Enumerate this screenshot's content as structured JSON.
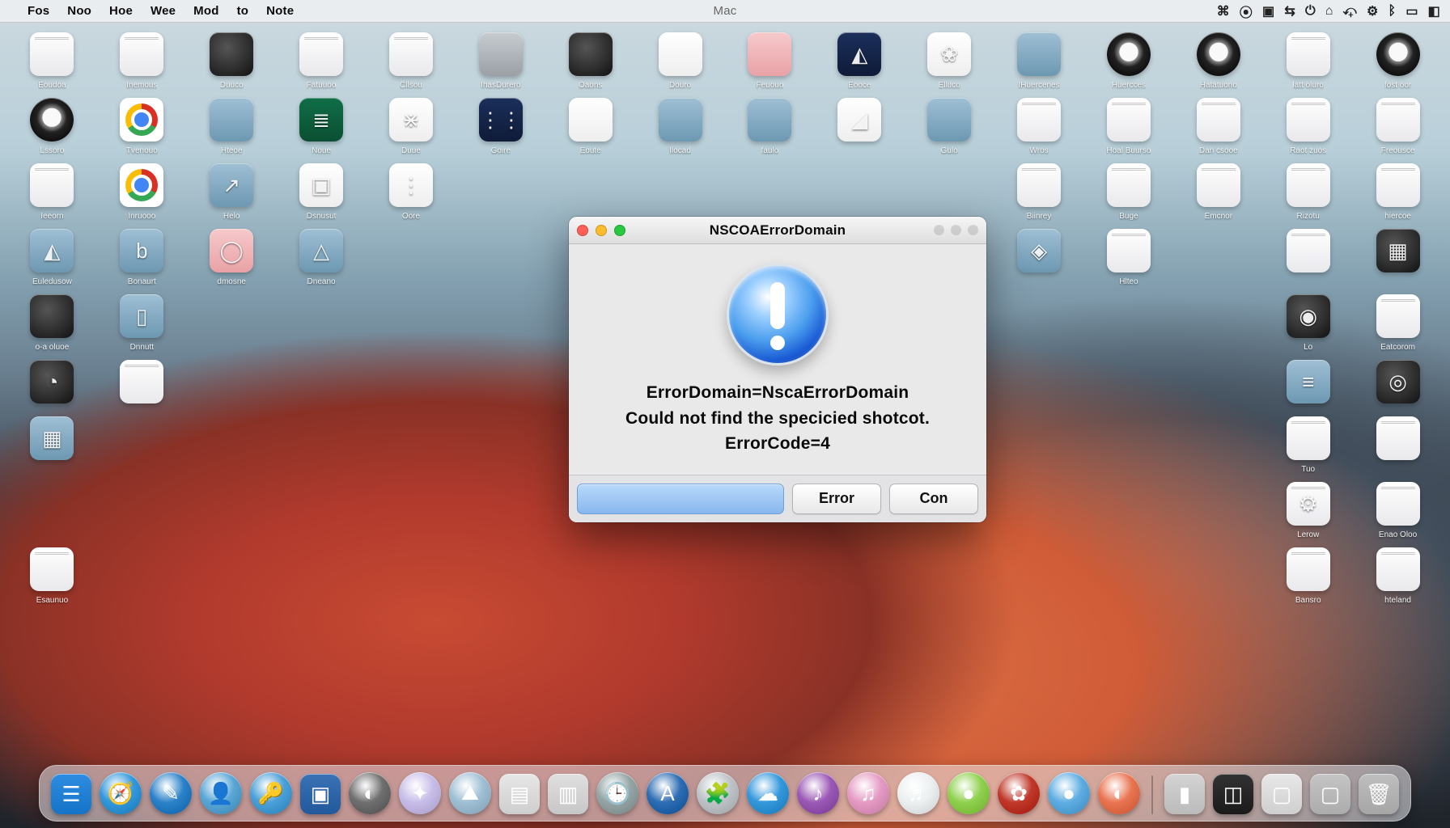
{
  "menubar": {
    "center": "Mac",
    "items": [
      "Fos",
      "Noo",
      "Hoe",
      "Wee",
      "Mod",
      "to",
      "Note"
    ]
  },
  "dialog": {
    "title": "NSCOAErrorDomain",
    "line1": "ErrorDomain=NscaErrorDomain",
    "line2": "Could not find the specicied shotcot.",
    "line3": "ErrorCode=4",
    "button1": "Error",
    "button2": "Con"
  },
  "icons": {
    "r1": [
      {
        "l": "Eoudoa",
        "t": "paper"
      },
      {
        "l": "Inemous",
        "t": "paper"
      },
      {
        "l": "Duuco",
        "t": "dark"
      },
      {
        "l": "Fatuuoo",
        "t": "paper"
      },
      {
        "l": "Cllsou",
        "t": "paper"
      },
      {
        "l": "IhasDurero",
        "t": "steel"
      },
      {
        "l": "Oaons",
        "t": "dark"
      },
      {
        "l": "Douro",
        "t": "white"
      },
      {
        "l": "Feuouo",
        "t": "pink"
      },
      {
        "l": "Eooce",
        "t": "navy",
        "g": "◭"
      },
      {
        "l": "Elluco",
        "t": "white",
        "g": "❀"
      },
      {
        "l": "IHuercenes",
        "t": "blue"
      },
      {
        "l": "Huercces",
        "t": "ring"
      },
      {
        "l": "Hatatuono",
        "t": "ring"
      },
      {
        "l": "latt oluro",
        "t": "paper"
      },
      {
        "l": "fost oor",
        "t": "ring"
      }
    ],
    "r2": [
      {
        "l": "Lssoro",
        "t": "ring"
      },
      {
        "l": "Tvenouo",
        "t": "chrome"
      },
      {
        "l": "Hteoe",
        "t": "blue"
      },
      {
        "l": "Noue",
        "t": "green",
        "g": "≣"
      },
      {
        "l": "Duue",
        "t": "white",
        "g": "⋇"
      },
      {
        "l": "Goire",
        "t": "navy",
        "g": "⋮⋮"
      },
      {
        "l": "Eoute",
        "t": "white"
      },
      {
        "l": "Ilocad",
        "t": "blue"
      },
      {
        "l": "faulo",
        "t": "blue"
      },
      {
        "l": "",
        "t": "white",
        "g": "◢"
      },
      {
        "l": "Gulo",
        "t": "blue"
      },
      {
        "l": "Wros",
        "t": "paper"
      },
      {
        "l": "Hoal Buurso",
        "t": "paper"
      },
      {
        "l": "Dan csooe",
        "t": "paper"
      },
      {
        "l": "Raot zuos",
        "t": "paper"
      },
      {
        "l": "Freousce",
        "t": "paper"
      }
    ],
    "r3": [
      {
        "l": "Ieeorn",
        "t": "paper"
      },
      {
        "l": "Inruooo",
        "t": "chrome"
      },
      {
        "l": "Helo",
        "t": "blue",
        "g": "↗"
      },
      {
        "l": "Dsnusut",
        "t": "white",
        "g": "▣"
      },
      {
        "l": "Oore",
        "t": "white",
        "g": "⋮"
      },
      {
        "l": "",
        "t": ""
      },
      {
        "l": "",
        "t": ""
      },
      {
        "l": "",
        "t": ""
      },
      {
        "l": "",
        "t": ""
      },
      {
        "l": "",
        "t": ""
      },
      {
        "l": "",
        "t": ""
      },
      {
        "l": "Biinrey",
        "t": "paper"
      },
      {
        "l": "Buge",
        "t": "paper"
      },
      {
        "l": "Emcnor",
        "t": "paper"
      },
      {
        "l": "Rizotu",
        "t": "paper"
      },
      {
        "l": "hiercoe",
        "t": "paper"
      }
    ],
    "r4": [
      {
        "l": "Euledusow",
        "t": "blue",
        "g": "◭"
      },
      {
        "l": "Bonaurt",
        "t": "blue",
        "g": "b"
      },
      {
        "l": "dmosne",
        "t": "pink",
        "g": "◯"
      },
      {
        "l": "Dneano",
        "t": "blue",
        "g": "△"
      },
      {
        "l": "",
        "t": ""
      },
      {
        "l": "",
        "t": ""
      },
      {
        "l": "",
        "t": ""
      },
      {
        "l": "",
        "t": ""
      },
      {
        "l": "",
        "t": ""
      },
      {
        "l": "",
        "t": ""
      },
      {
        "l": "",
        "t": ""
      },
      {
        "l": "",
        "t": "blue",
        "g": "◈"
      },
      {
        "l": "Hlteo",
        "t": "paper"
      },
      {
        "l": "",
        "t": ""
      },
      {
        "l": "",
        "t": "paper"
      },
      {
        "l": "",
        "t": "dark",
        "g": "▦"
      }
    ],
    "r5": [
      {
        "l": "o-a oluoe",
        "t": "dark"
      },
      {
        "l": "Dnnutt",
        "t": "blue",
        "g": "▯"
      },
      {
        "l": "",
        "t": ""
      },
      {
        "l": "",
        "t": ""
      },
      {
        "l": "",
        "t": ""
      },
      {
        "l": "",
        "t": ""
      },
      {
        "l": "",
        "t": ""
      },
      {
        "l": "",
        "t": ""
      },
      {
        "l": "",
        "t": ""
      },
      {
        "l": "",
        "t": ""
      },
      {
        "l": "",
        "t": ""
      },
      {
        "l": "",
        "t": ""
      },
      {
        "l": "",
        "t": ""
      },
      {
        "l": "",
        "t": ""
      },
      {
        "l": "Lo",
        "t": "dark",
        "g": "◉"
      },
      {
        "l": "Eatcorom",
        "t": "paper"
      }
    ],
    "r6": [
      {
        "l": "",
        "t": "dark",
        "g": "◔"
      },
      {
        "l": "",
        "t": "paper",
        "g": ""
      },
      {
        "l": "",
        "t": ""
      },
      {
        "l": "",
        "t": ""
      },
      {
        "l": "",
        "t": ""
      },
      {
        "l": "",
        "t": ""
      },
      {
        "l": "",
        "t": ""
      },
      {
        "l": "",
        "t": ""
      },
      {
        "l": "",
        "t": ""
      },
      {
        "l": "",
        "t": ""
      },
      {
        "l": "",
        "t": ""
      },
      {
        "l": "",
        "t": ""
      },
      {
        "l": "",
        "t": ""
      },
      {
        "l": "",
        "t": ""
      },
      {
        "l": "",
        "t": "blue",
        "g": "≡"
      },
      {
        "l": "",
        "t": "dark",
        "g": "◎"
      }
    ],
    "r7": [
      {
        "l": "",
        "t": "blue",
        "g": "▦"
      },
      {
        "l": "",
        "t": ""
      },
      {
        "l": "",
        "t": ""
      },
      {
        "l": "",
        "t": ""
      },
      {
        "l": "",
        "t": ""
      },
      {
        "l": "",
        "t": ""
      },
      {
        "l": "",
        "t": ""
      },
      {
        "l": "",
        "t": ""
      },
      {
        "l": "",
        "t": ""
      },
      {
        "l": "",
        "t": ""
      },
      {
        "l": "",
        "t": ""
      },
      {
        "l": "",
        "t": ""
      },
      {
        "l": "",
        "t": ""
      },
      {
        "l": "",
        "t": ""
      },
      {
        "l": "Tuo",
        "t": "paper"
      },
      {
        "l": "",
        "t": "paper"
      }
    ],
    "r8": [
      {
        "l": "",
        "t": ""
      },
      {
        "l": "",
        "t": ""
      },
      {
        "l": "",
        "t": ""
      },
      {
        "l": "",
        "t": ""
      },
      {
        "l": "",
        "t": ""
      },
      {
        "l": "",
        "t": ""
      },
      {
        "l": "",
        "t": ""
      },
      {
        "l": "",
        "t": ""
      },
      {
        "l": "",
        "t": ""
      },
      {
        "l": "",
        "t": ""
      },
      {
        "l": "",
        "t": ""
      },
      {
        "l": "",
        "t": ""
      },
      {
        "l": "",
        "t": ""
      },
      {
        "l": "",
        "t": ""
      },
      {
        "l": "Lerow",
        "t": "paper",
        "g": "⚙"
      },
      {
        "l": "Enao Oloo",
        "t": "paper"
      }
    ],
    "r9": [
      {
        "l": "Esaunuo",
        "t": "paper"
      },
      {
        "l": "",
        "t": ""
      },
      {
        "l": "",
        "t": ""
      },
      {
        "l": "",
        "t": ""
      },
      {
        "l": "",
        "t": ""
      },
      {
        "l": "",
        "t": ""
      },
      {
        "l": "",
        "t": ""
      },
      {
        "l": "",
        "t": ""
      },
      {
        "l": "",
        "t": ""
      },
      {
        "l": "",
        "t": ""
      },
      {
        "l": "",
        "t": ""
      },
      {
        "l": "",
        "t": ""
      },
      {
        "l": "",
        "t": ""
      },
      {
        "l": "",
        "t": ""
      },
      {
        "l": "Bansro",
        "t": "paper"
      },
      {
        "l": "hteland",
        "t": "paper"
      }
    ]
  },
  "dock": [
    {
      "c": "#2e8de1",
      "g": "☰",
      "sq": true
    },
    {
      "c": "#3498db",
      "g": "🧭"
    },
    {
      "c": "#2b82c9",
      "g": "✎"
    },
    {
      "c": "#5aa7d6",
      "g": "👤"
    },
    {
      "c": "#4aa0d8",
      "g": "🔑"
    },
    {
      "c": "#3b72b5",
      "g": "▣",
      "sq": true
    },
    {
      "c": "#6f6f6f",
      "g": "◐"
    },
    {
      "c": "#c7bde8",
      "g": "✦"
    },
    {
      "c": "#9fbfd4",
      "g": "⛰"
    },
    {
      "c": "#e7e7e7",
      "g": "▤",
      "sq": true
    },
    {
      "c": "#e0e0e0",
      "g": "▥",
      "sq": true
    },
    {
      "c": "#95a5a6",
      "g": "🕒"
    },
    {
      "c": "#2d6db3",
      "g": "A"
    },
    {
      "c": "#bdc3c7",
      "g": "🧩"
    },
    {
      "c": "#3498db",
      "g": "☁"
    },
    {
      "c": "#9b59b6",
      "g": "♪"
    },
    {
      "c": "#e59ac4",
      "g": "♫"
    },
    {
      "c": "#ecf0f1",
      "g": "♬"
    },
    {
      "c": "#8fd14f",
      "g": "●"
    },
    {
      "c": "#c0392b",
      "g": "✿"
    },
    {
      "c": "#5dade2",
      "g": "●"
    },
    {
      "c": "#e97451",
      "g": "◐"
    },
    {
      "c": "#d4d4d4",
      "g": "▮",
      "sq": true
    },
    {
      "c": "#333333",
      "g": "◫",
      "sq": true
    },
    {
      "c": "#e8e8e8",
      "g": "▢",
      "sq": true
    },
    {
      "c": "#c5c5c5",
      "g": "▢",
      "sq": true
    },
    {
      "c": "#bfbfbf",
      "g": "🗑",
      "sq": true
    }
  ]
}
